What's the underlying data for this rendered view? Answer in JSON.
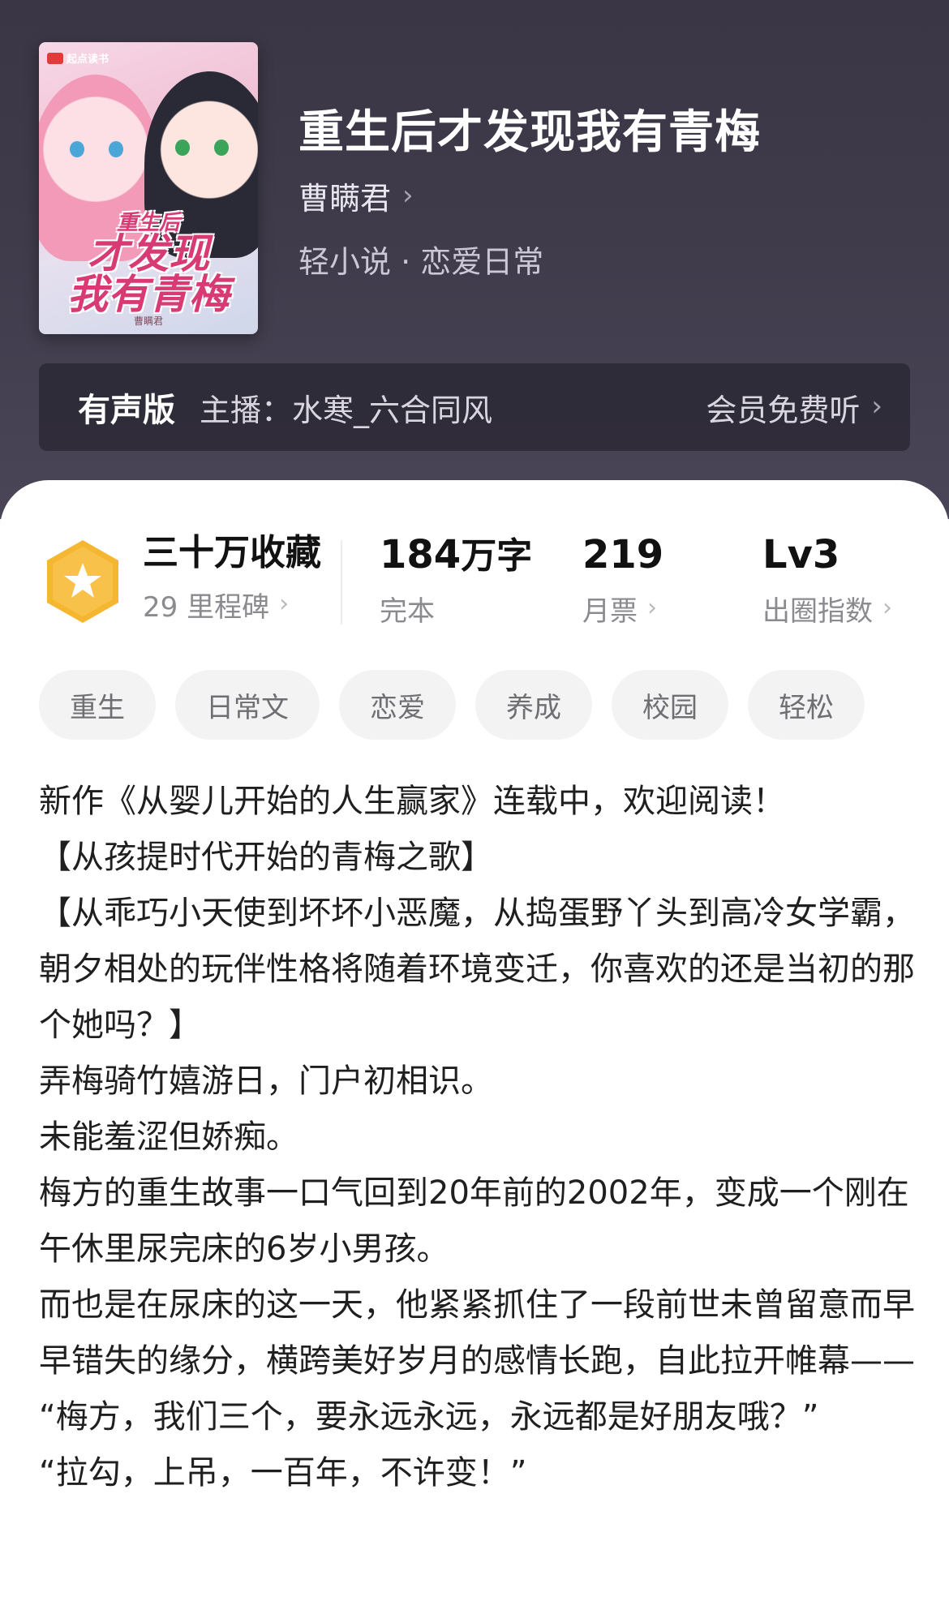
{
  "book": {
    "title": "重生后才发现我有青梅",
    "author": "曹瞒君",
    "genre": "轻小说 · 恋爱日常"
  },
  "cover": {
    "brand": "起点读书",
    "title_line1": "重生后",
    "title_line2": "才发现",
    "title_line3": "我有青梅",
    "author_mark": "曹瞒君"
  },
  "audio": {
    "label": "有声版",
    "host": "主播：水寒_六合同风",
    "action": "会员免费听"
  },
  "stats": {
    "collect_main": "三十万收藏",
    "collect_sub": "29 里程碑",
    "words_num": "184",
    "words_unit": "万字",
    "words_sub": "完本",
    "votes_main": "219",
    "votes_sub": "月票",
    "level_main": "Lv3",
    "level_sub": "出圈指数"
  },
  "tags": [
    "重生",
    "日常文",
    "恋爱",
    "养成",
    "校园",
    "轻松"
  ],
  "intro": [
    "新作《从婴儿开始的人生赢家》连载中，欢迎阅读！",
    "【从孩提时代开始的青梅之歌】",
    "【从乖巧小天使到坏坏小恶魔，从捣蛋野丫头到高冷女学霸，朝夕相处的玩伴性格将随着环境变迁，你喜欢的还是当初的那个她吗？】",
    "弄梅骑竹嬉游日，门户初相识。",
    "未能羞涩但娇痴。",
    "梅方的重生故事一口气回到20年前的2002年，变成一个刚在午休里尿完床的6岁小男孩。",
    "而也是在尿床的这一天，他紧紧抓住了一段前世未曾留意而早早错失的缘分，横跨美好岁月的感情长跑，自此拉开帷幕——",
    "“梅方，我们三个，要永远永远，永远都是好朋友哦？”",
    "“拉勾，上吊，一百年，不许变！”"
  ],
  "colors": {
    "header_bg": "#3f3b4b",
    "badge": "#f5b731",
    "tag_bg": "#f3f3f4"
  },
  "icons": {
    "badge": "star-badge-icon",
    "chevron": "chevron-right-icon"
  }
}
